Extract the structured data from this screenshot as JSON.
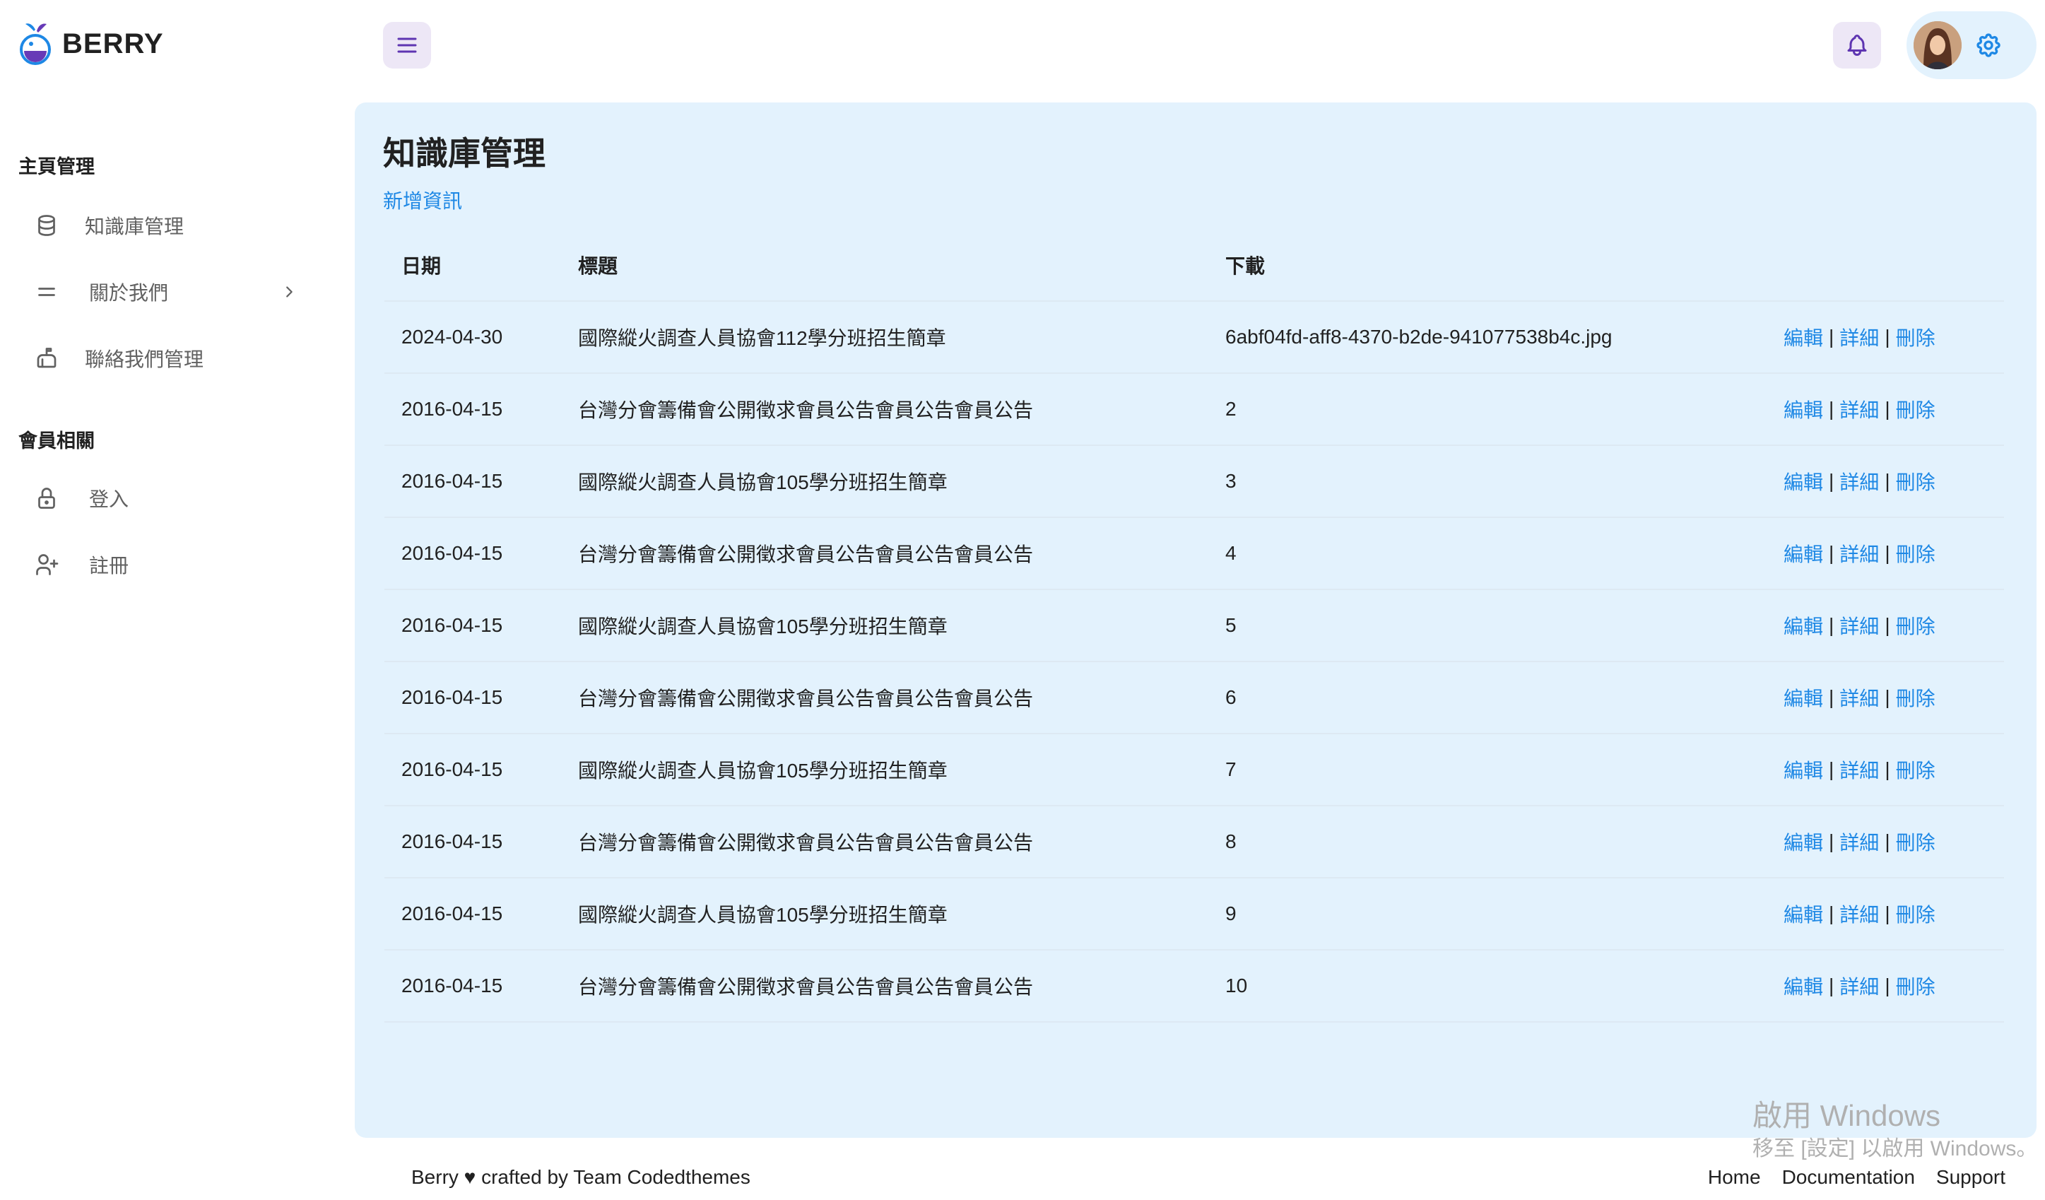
{
  "brand": {
    "name": "BERRY",
    "logo_icon": "berry-logo-icon",
    "accent": "#673ab7"
  },
  "header": {
    "menu_icon": "hamburger-icon",
    "bell_icon": "bell-icon",
    "settings_icon": "gear-icon"
  },
  "sidebar": {
    "groups": [
      {
        "title": "主頁管理",
        "items": [
          {
            "label": "知識庫管理",
            "icon": "database-icon"
          },
          {
            "label": "關於我們",
            "icon": "menu-lines-icon",
            "has_children": true
          },
          {
            "label": "聯絡我們管理",
            "icon": "mailbox-icon"
          }
        ]
      },
      {
        "title": "會員相關",
        "items": [
          {
            "label": "登入",
            "icon": "lock-icon"
          },
          {
            "label": "註冊",
            "icon": "user-plus-icon"
          }
        ]
      }
    ]
  },
  "main": {
    "title": "知識庫管理",
    "add_link": "新增資訊",
    "table": {
      "headers": {
        "date": "日期",
        "title": "標題",
        "download": "下載"
      },
      "actions": {
        "edit": "編輯",
        "detail": "詳細",
        "delete": "刪除",
        "sep": "|"
      },
      "rows": [
        {
          "date": "2024-04-30",
          "title": "國際縱火調查人員協會112學分班招生簡章",
          "download": "6abf04fd-aff8-4370-b2de-941077538b4c.jpg"
        },
        {
          "date": "2016-04-15",
          "title": "台灣分會籌備會公開徵求會員公告會員公告會員公告",
          "download": "2"
        },
        {
          "date": "2016-04-15",
          "title": "國際縱火調查人員協會105學分班招生簡章",
          "download": "3"
        },
        {
          "date": "2016-04-15",
          "title": "台灣分會籌備會公開徵求會員公告會員公告會員公告",
          "download": "4"
        },
        {
          "date": "2016-04-15",
          "title": "國際縱火調查人員協會105學分班招生簡章",
          "download": "5"
        },
        {
          "date": "2016-04-15",
          "title": "台灣分會籌備會公開徵求會員公告會員公告會員公告",
          "download": "6"
        },
        {
          "date": "2016-04-15",
          "title": "國際縱火調查人員協會105學分班招生簡章",
          "download": "7"
        },
        {
          "date": "2016-04-15",
          "title": "台灣分會籌備會公開徵求會員公告會員公告會員公告",
          "download": "8"
        },
        {
          "date": "2016-04-15",
          "title": "國際縱火調查人員協會105學分班招生簡章",
          "download": "9"
        },
        {
          "date": "2016-04-15",
          "title": "台灣分會籌備會公開徵求會員公告會員公告會員公告",
          "download": "10"
        }
      ]
    }
  },
  "watermark": {
    "line1": "啟用 Windows",
    "line2": "移至 [設定] 以啟用 Windows。"
  },
  "footer": {
    "credit": "Berry ♥ crafted by Team Codedthemes",
    "links": [
      "Home",
      "Documentation",
      "Support"
    ]
  },
  "colors": {
    "link": "#1e88e5",
    "main_bg": "#e3f2fd",
    "chip_bg": "#ede7f6"
  }
}
